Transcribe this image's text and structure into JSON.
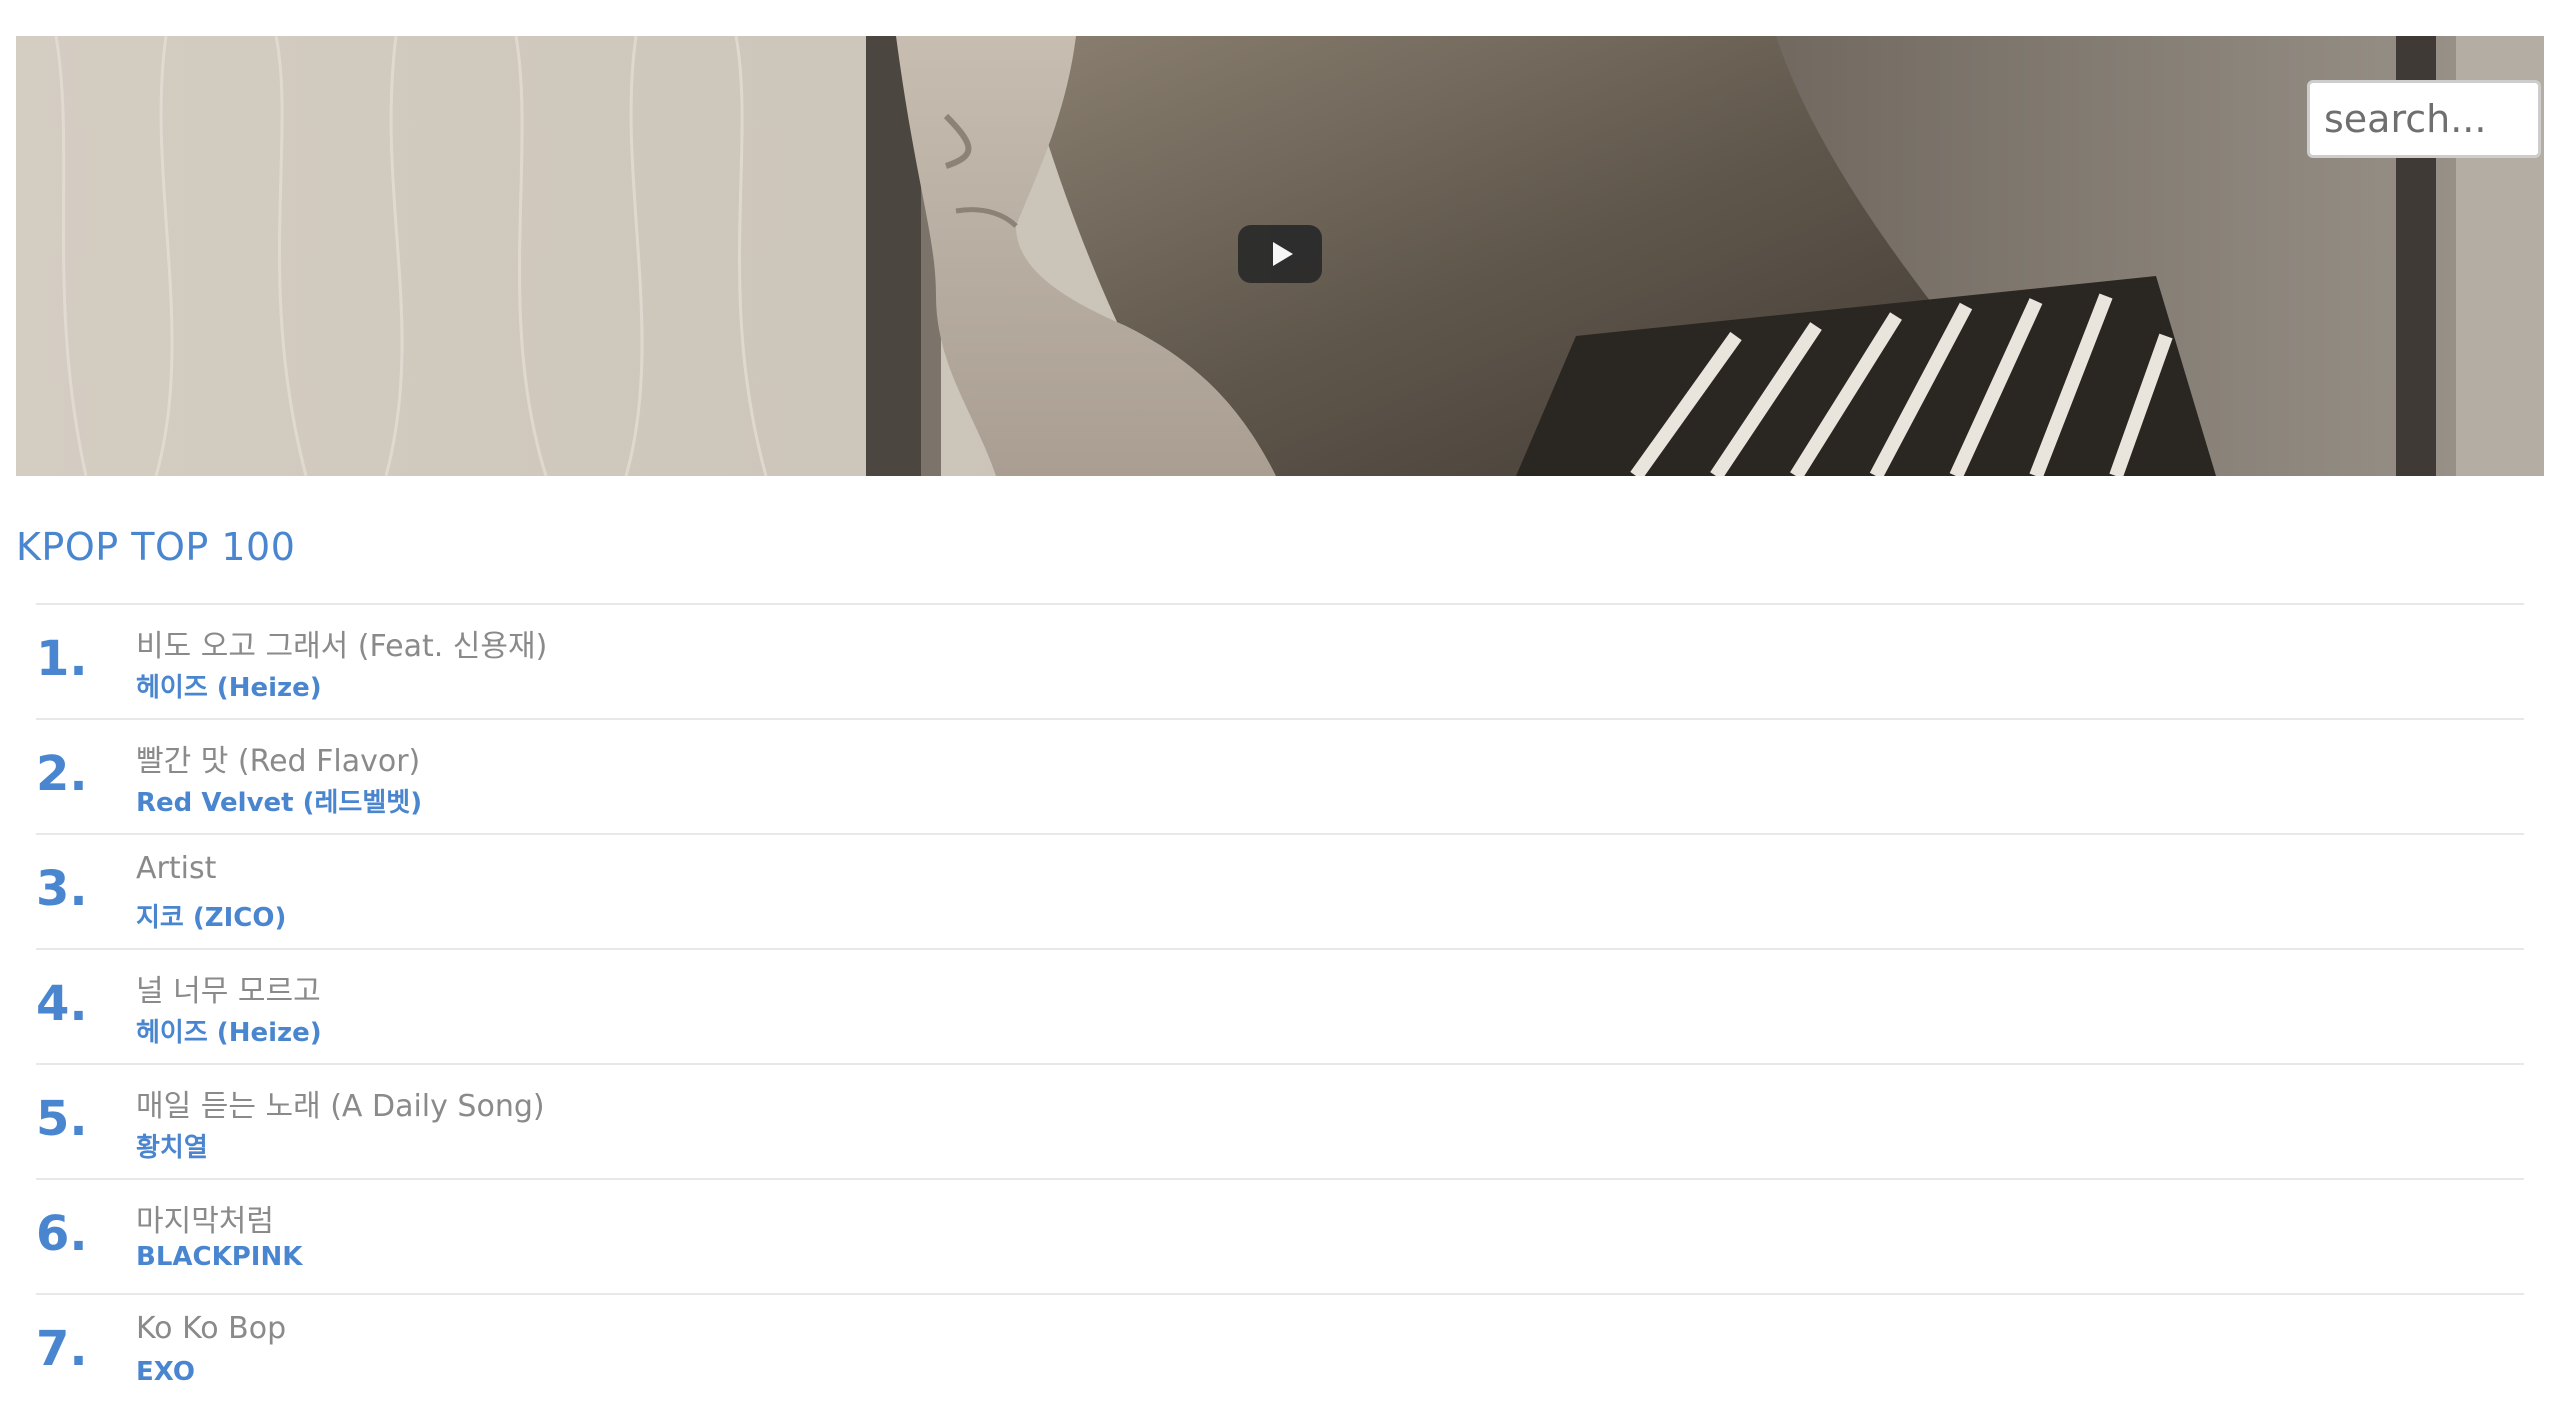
{
  "search": {
    "placeholder": "search..."
  },
  "video": {
    "play_icon": "play-icon"
  },
  "chart": {
    "title": "KPOP TOP 100",
    "songs": [
      {
        "rank": "1.",
        "title": "비도 오고 그래서 (Feat. 신용재)",
        "artist": "헤이즈 (Heize)"
      },
      {
        "rank": "2.",
        "title": "빨간 맛 (Red Flavor)",
        "artist": "Red Velvet (레드벨벳)"
      },
      {
        "rank": "3.",
        "title": "Artist",
        "artist": "지코 (ZICO)"
      },
      {
        "rank": "4.",
        "title": "널 너무 모르고",
        "artist": "헤이즈 (Heize)"
      },
      {
        "rank": "5.",
        "title": "매일 듣는 노래 (A Daily Song)",
        "artist": "황치열"
      },
      {
        "rank": "6.",
        "title": "마지막처럼",
        "artist": "BLACKPINK"
      },
      {
        "rank": "7.",
        "title": "Ko Ko Bop",
        "artist": "EXO"
      }
    ]
  },
  "colors": {
    "accent": "#4a86d0",
    "song_title": "#8a8a8a",
    "divider": "#e8e8e8"
  }
}
